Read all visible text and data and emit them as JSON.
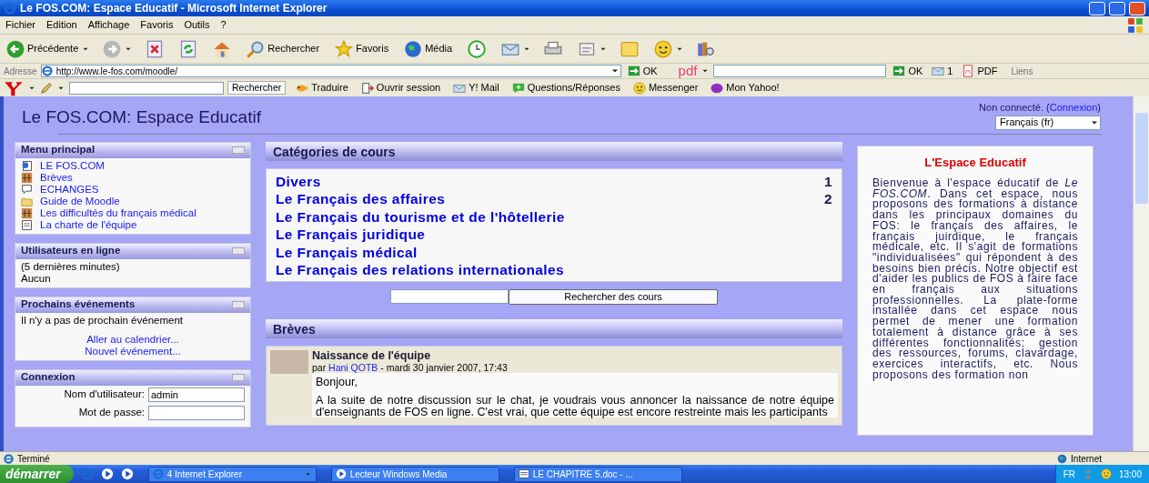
{
  "window": {
    "title": "Le FOS.COM: Espace Educatif - Microsoft Internet Explorer"
  },
  "menu_bar": [
    "Fichier",
    "Edition",
    "Affichage",
    "Favoris",
    "Outils",
    "?"
  ],
  "toolbar": [
    {
      "kind": "back",
      "label": "Précédente",
      "dropdown": true
    },
    {
      "kind": "forward",
      "dropdown": true
    },
    {
      "kind": "stop",
      "dropdown": false
    },
    {
      "kind": "refresh",
      "dropdown": false
    },
    {
      "kind": "home",
      "dropdown": false
    },
    {
      "kind": "search",
      "label": "Rechercher",
      "dropdown": false
    },
    {
      "kind": "favorites",
      "label": "Favoris",
      "dropdown": false
    },
    {
      "kind": "media",
      "label": "Média",
      "dropdown": false
    },
    {
      "kind": "history",
      "dropdown": false
    },
    {
      "kind": "mail",
      "dropdown": true
    },
    {
      "kind": "print",
      "dropdown": false
    },
    {
      "kind": "edit",
      "dropdown": true
    },
    {
      "kind": "note",
      "dropdown": false
    },
    {
      "kind": "messenger",
      "dropdown": true
    },
    {
      "kind": "research",
      "dropdown": false
    }
  ],
  "address_bar": {
    "label": "Adresse",
    "url": "http://www.le-fos.com/moodle/",
    "go": "OK",
    "pdf_label": "pdf",
    "go_second": "OK",
    "count": "1",
    "pdf_button": "PDF",
    "links": "Liens"
  },
  "yahoo_bar": {
    "search_button": "Rechercher",
    "items": [
      {
        "kind": "translate",
        "label": "Traduire"
      },
      {
        "kind": "session",
        "label": "Ouvrir session"
      },
      {
        "kind": "mail",
        "label": "Y! Mail"
      },
      {
        "kind": "answers",
        "label": "Questions/Réponses"
      },
      {
        "kind": "messenger",
        "label": "Messenger"
      },
      {
        "kind": "myyahoo",
        "label": "Mon Yahoo!"
      }
    ]
  },
  "page": {
    "site_title": "Le FOS.COM: Espace Educatif",
    "login_prefix": "Non connecté. (",
    "login_link": "Connexion",
    "login_suffix": ")",
    "language": "Français (fr)",
    "main_menu": {
      "title": "Menu principal",
      "items": [
        {
          "kind": "web",
          "label": "LE FOS.COM"
        },
        {
          "kind": "forum",
          "label": "Brèves"
        },
        {
          "kind": "chat",
          "label": "ECHANGES"
        },
        {
          "kind": "folder",
          "label": "Guide de Moodle"
        },
        {
          "kind": "forum",
          "label": "Les difficultés du français médical"
        },
        {
          "kind": "page",
          "label": "La charte de l'équipe"
        }
      ]
    },
    "online_users": {
      "title": "Utilisateurs en ligne",
      "lines": [
        "(5 dernières minutes)",
        "Aucun"
      ]
    },
    "events": {
      "title": "Prochains événements",
      "text": "Il n'y a pas de prochain événement",
      "links": [
        "Aller au calendrier...",
        "Nouvel événement..."
      ]
    },
    "login": {
      "title": "Connexion",
      "fields": [
        {
          "label": "Nom d'utilisateur:",
          "value": "admin"
        },
        {
          "label": "Mot de passe:"
        }
      ]
    },
    "categories": {
      "title": "Catégories de cours",
      "items": [
        {
          "name": "Divers",
          "count": "1"
        },
        {
          "name": "Le Français des affaires",
          "count": "2"
        },
        {
          "name": "Le Français du tourisme et de l'hôtellerie"
        },
        {
          "name": "Le Français juridique"
        },
        {
          "name": "Le Français médical"
        },
        {
          "name": "Le Français des relations internationales"
        }
      ]
    },
    "course_search_button": "Rechercher des cours",
    "news": {
      "title": "Brèves",
      "post": {
        "title": "Naissance de l'équipe",
        "by": "par",
        "author": "Hani QOTB",
        "date": "- mardi 30 janvier 2007, 17:43",
        "paragraphs": [
          "Bonjour,",
          "A la suite de notre discussion sur le chat, je voudrais vous annoncer la naissance de notre équipe d'enseignants de FOS en ligne. C'est vrai, que cette équipe est encore restreinte mais les participants"
        ]
      }
    },
    "welcome": {
      "title": "L'Espace Educatif",
      "text": "Bienvenue à l'espace éducatif de *Le FOS.COM*. Dans cet espace, nous proposons des formations à distance dans les principaux domaines du FOS: le français des affaires, le français juirdique, le français médicale, etc. Il s'agit de formations \"individualisées\" qui répondent à des besoins bien précis. Notre objectif est d'aider les publics de FOS à faire face en français aux situations professionnelles. La plate-forme installée dans cet espace nous permet de mener une formation totalement à distance grâce à ses différentes fonctionnalités: gestion des ressources, forums, clavardage, exercices interactifs, etc. Nous proposons des formation non"
    }
  },
  "status_bar": {
    "text": "Terminé",
    "zone": "Internet"
  },
  "taskbar": {
    "start": "démarrer",
    "tasks": [
      {
        "label": "4 Internet Explorer",
        "dropdown": true
      },
      {
        "label": "Lecteur Windows Media",
        "dropdown": false
      },
      {
        "label": "LE CHAPITRE 5.doc - ...",
        "dropdown": false
      }
    ],
    "language": "FR",
    "clock": "13:00"
  }
}
